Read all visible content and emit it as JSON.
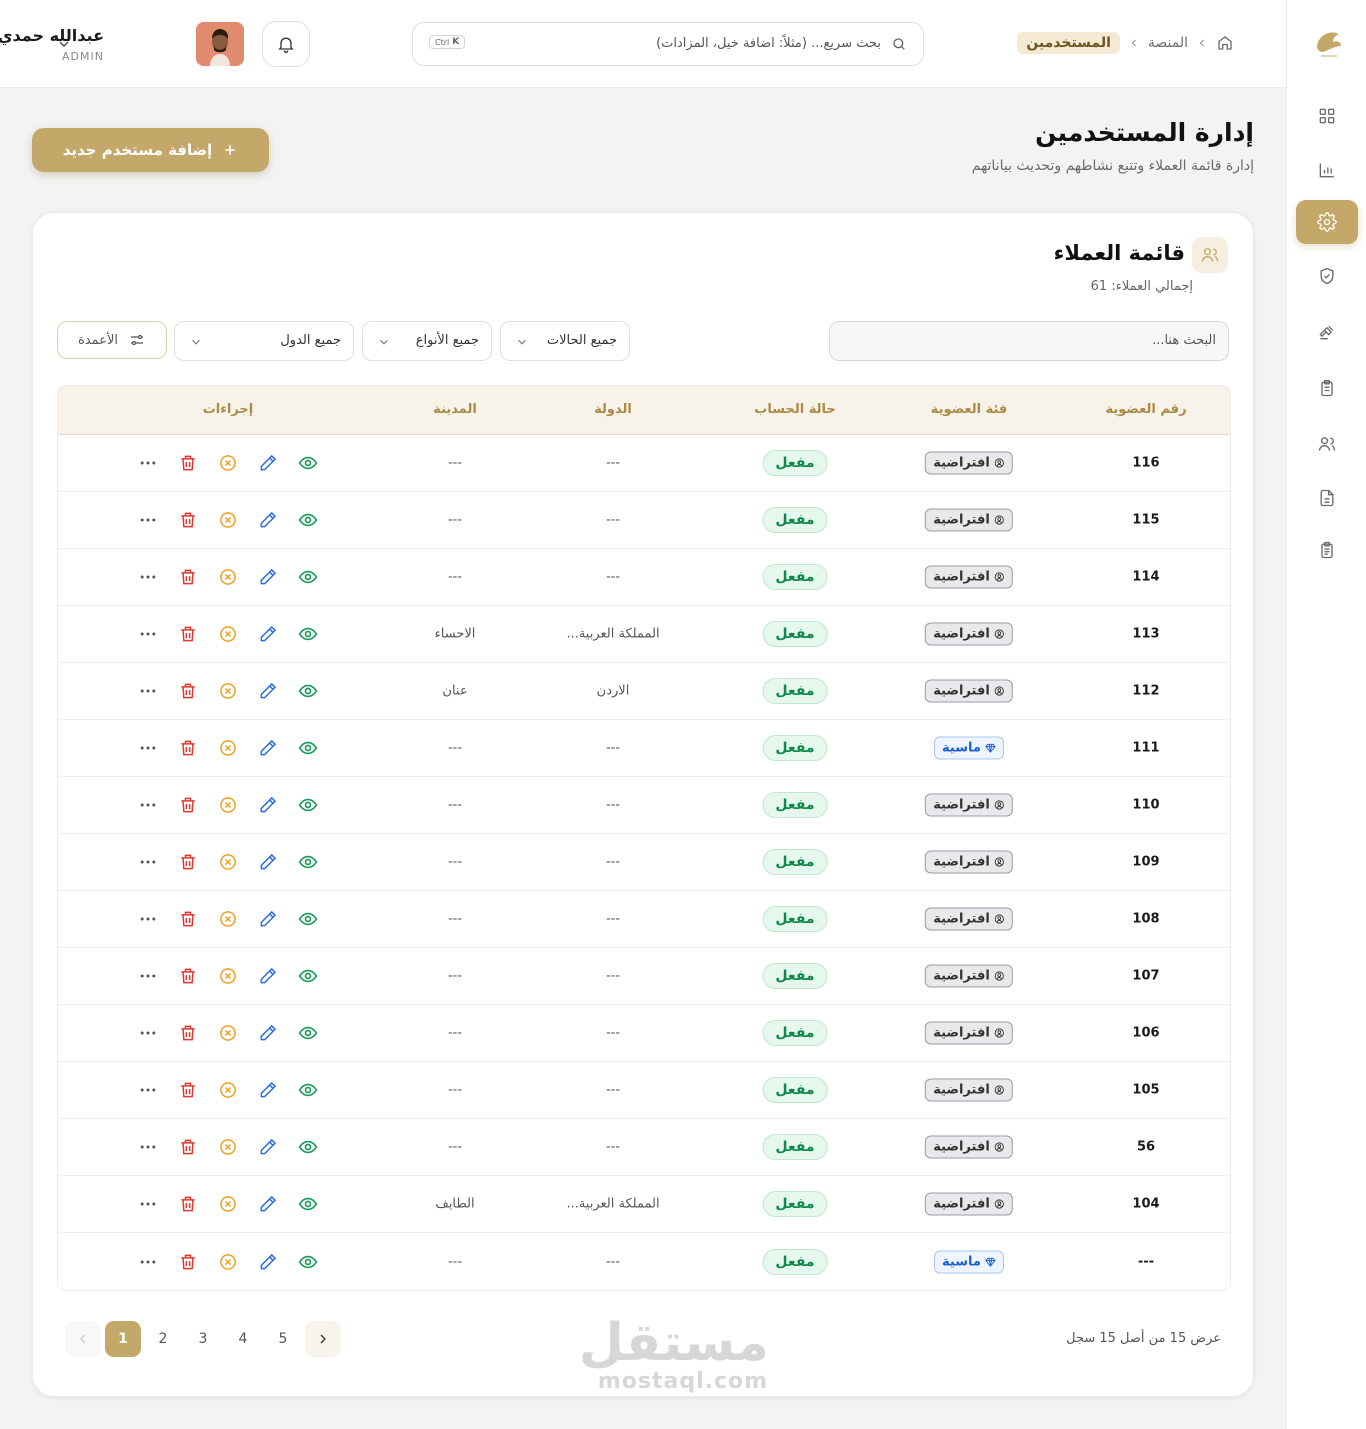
{
  "topbar": {
    "breadcrumb": {
      "home_icon": "home-icon",
      "items": [
        "المنصة",
        "المستخدمين"
      ]
    },
    "search_placeholder": "بحث سريع... (مثلاً: اضافة خيل، المزادات)",
    "shortcut": {
      "mod": "Ctrl",
      "key": "K"
    },
    "user": {
      "name": "عبدالله حمدي",
      "role": "ADMIN"
    }
  },
  "sidebar": {
    "logo": "brand-logo",
    "items": [
      "grid-icon",
      "chart-icon",
      "settings-icon",
      "shield-check-icon",
      "gavel-icon",
      "clipboard-icon",
      "users-icon",
      "file-icon",
      "clipboard-list-icon"
    ],
    "active": "settings-icon"
  },
  "page": {
    "title": "إدارة المستخدمين",
    "subtitle": "إدارة قائمة العملاء وتتبع نشاطهم وتحديث بياناتهم",
    "add_button": "إضافة مستخدم جديد"
  },
  "card": {
    "title": "قائمة العملاء",
    "total": "إجمالي العملاء: 61",
    "search_placeholder": "البحث هنا...",
    "filters": {
      "status": "جميع الحالات",
      "types": "جميع الأنواع",
      "countries": "جميع الدول"
    },
    "columns_button": "الأعمدة"
  },
  "table": {
    "headers": {
      "id": "رقم العضوية",
      "tier": "فئة العضوية",
      "status": "حالة الحساب",
      "country": "الدولة",
      "city": "المدينة",
      "actions": "إجراءات"
    },
    "rows": [
      {
        "id": "116",
        "tier": "افتراضية",
        "tier_type": "default",
        "status": "مفعل",
        "country": "---",
        "city": "---"
      },
      {
        "id": "115",
        "tier": "افتراضية",
        "tier_type": "default",
        "status": "مفعل",
        "country": "---",
        "city": "---"
      },
      {
        "id": "114",
        "tier": "افتراضية",
        "tier_type": "default",
        "status": "مفعل",
        "country": "---",
        "city": "---"
      },
      {
        "id": "113",
        "tier": "افتراضية",
        "tier_type": "default",
        "status": "مفعل",
        "country": "المملكة العربية...",
        "city": "الاحساء"
      },
      {
        "id": "112",
        "tier": "افتراضية",
        "tier_type": "default",
        "status": "مفعل",
        "country": "الاردن",
        "city": "عنان"
      },
      {
        "id": "111",
        "tier": "ماسية",
        "tier_type": "diamond",
        "status": "مفعل",
        "country": "---",
        "city": "---"
      },
      {
        "id": "110",
        "tier": "افتراضية",
        "tier_type": "default",
        "status": "مفعل",
        "country": "---",
        "city": "---"
      },
      {
        "id": "109",
        "tier": "افتراضية",
        "tier_type": "default",
        "status": "مفعل",
        "country": "---",
        "city": "---"
      },
      {
        "id": "108",
        "tier": "افتراضية",
        "tier_type": "default",
        "status": "مفعل",
        "country": "---",
        "city": "---"
      },
      {
        "id": "107",
        "tier": "افتراضية",
        "tier_type": "default",
        "status": "مفعل",
        "country": "---",
        "city": "---"
      },
      {
        "id": "106",
        "tier": "افتراضية",
        "tier_type": "default",
        "status": "مفعل",
        "country": "---",
        "city": "---"
      },
      {
        "id": "105",
        "tier": "افتراضية",
        "tier_type": "default",
        "status": "مفعل",
        "country": "---",
        "city": "---"
      },
      {
        "id": "56",
        "tier": "افتراضية",
        "tier_type": "default",
        "status": "مفعل",
        "country": "---",
        "city": "---"
      },
      {
        "id": "104",
        "tier": "افتراضية",
        "tier_type": "default",
        "status": "مفعل",
        "country": "المملكة العربية...",
        "city": "الطايف"
      },
      {
        "id": "---",
        "tier": "ماسية",
        "tier_type": "diamond",
        "status": "مفعل",
        "country": "---",
        "city": "---"
      }
    ],
    "row_actions": [
      "view-icon",
      "edit-icon",
      "cancel-icon",
      "delete-icon",
      "more-icon"
    ]
  },
  "pagination": {
    "summary": "عرض 15 من أصل 15 سجل",
    "pages": [
      "1",
      "2",
      "3",
      "4",
      "5"
    ],
    "current": "1"
  },
  "watermark": {
    "arabic": "مستقل",
    "latin": "mostaql.com"
  },
  "colors": {
    "accent": "#c4a86a",
    "status_green": "#0f8a4a",
    "diamond_blue": "#1d5fd0",
    "danger": "#e0382f"
  }
}
